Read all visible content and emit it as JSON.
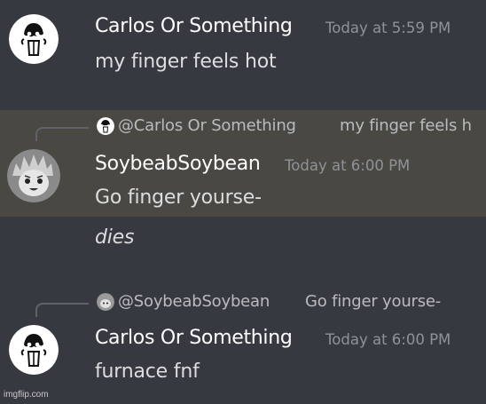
{
  "colors": {
    "background": "#36393f",
    "highlight": "#4a4843",
    "username": "#ffffff",
    "timestamp": "#8f9297",
    "message": "#dcddde",
    "reply": "#b9bbbe"
  },
  "messages": [
    {
      "username": "Carlos Or Something",
      "timestamp": "Today at 5:59 PM",
      "lines": [
        "my finger feels hot"
      ],
      "avatar": "doodle-character-avatar"
    },
    {
      "reply": {
        "mention": "@Carlos Or Something",
        "text": "my finger feels h"
      },
      "username": "SoybeabSoybean",
      "timestamp": "Today at 6:00 PM",
      "lines": [
        "Go finger yourse-",
        "dies"
      ],
      "avatar": "anime-character-avatar"
    },
    {
      "reply": {
        "mention": "@SoybeabSoybean",
        "text": "Go finger yourse-"
      },
      "username": "Carlos Or Something",
      "timestamp": "Today at 6:00 PM",
      "lines": [
        "furnace fnf"
      ],
      "avatar": "doodle-character-avatar"
    }
  ],
  "watermark": "imgflip.com"
}
